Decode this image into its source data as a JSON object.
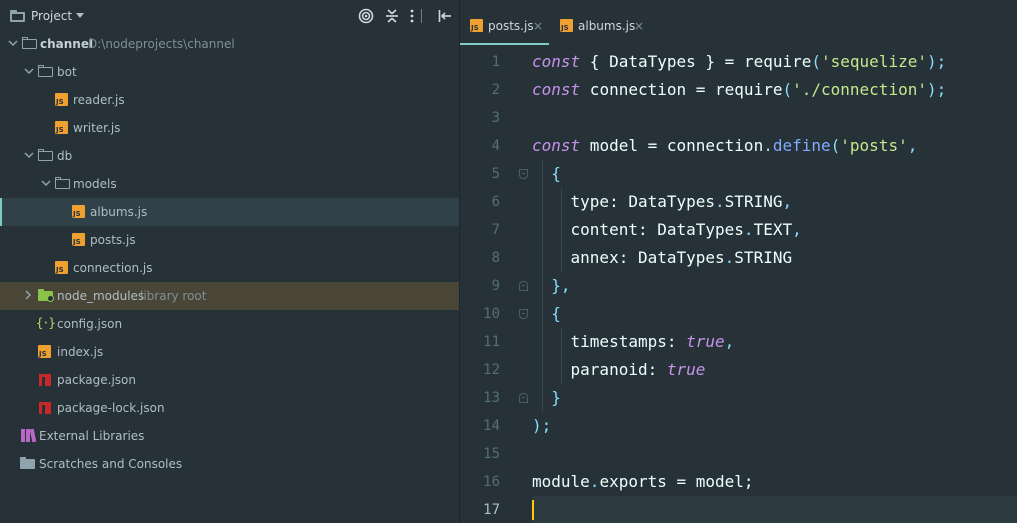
{
  "project_panel": {
    "title": "Project",
    "toolbar_icons": [
      "target-icon",
      "collapse-all-icon",
      "more-vert-icon",
      "hide-panel-icon"
    ],
    "tree": [
      {
        "label": "channel",
        "path": "D:\\nodeprojects\\channel",
        "type": "folder",
        "expanded": true,
        "depth": 0,
        "bold": true
      },
      {
        "label": "bot",
        "type": "folder",
        "expanded": true,
        "depth": 1
      },
      {
        "label": "reader.js",
        "type": "js",
        "depth": 2
      },
      {
        "label": "writer.js",
        "type": "js",
        "depth": 2
      },
      {
        "label": "db",
        "type": "folder",
        "expanded": true,
        "depth": 1
      },
      {
        "label": "models",
        "type": "folder",
        "expanded": true,
        "depth": 2
      },
      {
        "label": "albums.js",
        "type": "js",
        "depth": 3,
        "selected": true
      },
      {
        "label": "posts.js",
        "type": "js",
        "depth": 3
      },
      {
        "label": "connection.js",
        "type": "js",
        "depth": 2
      },
      {
        "label": "node_modules",
        "path": "library root",
        "type": "lib-folder",
        "expanded": false,
        "depth": 1,
        "excluded": true
      },
      {
        "label": "config.json",
        "type": "json",
        "depth": 1
      },
      {
        "label": "index.js",
        "type": "js",
        "depth": 1
      },
      {
        "label": "package.json",
        "type": "npm",
        "depth": 1
      },
      {
        "label": "package-lock.json",
        "type": "npm",
        "depth": 1
      },
      {
        "label": "External Libraries",
        "type": "libraries",
        "depth": 0
      },
      {
        "label": "Scratches and Consoles",
        "type": "scratches",
        "depth": 0
      }
    ]
  },
  "editor": {
    "tabs": [
      {
        "label": "posts.js",
        "close": "×",
        "active": true
      },
      {
        "label": "albums.js",
        "close": "×",
        "active": false
      }
    ],
    "current_line": 17,
    "lines": [
      [
        {
          "t": "const",
          "c": "kw"
        },
        {
          "t": " { DataTypes } = ",
          "c": "plain"
        },
        {
          "t": "require",
          "c": "plain"
        },
        {
          "t": "(",
          "c": "punc"
        },
        {
          "t": "'sequelize'",
          "c": "str"
        },
        {
          "t": ");",
          "c": "punc"
        }
      ],
      [
        {
          "t": "const",
          "c": "kw"
        },
        {
          "t": " connection = ",
          "c": "plain"
        },
        {
          "t": "require",
          "c": "plain"
        },
        {
          "t": "(",
          "c": "punc"
        },
        {
          "t": "'./connection'",
          "c": "str"
        },
        {
          "t": ");",
          "c": "punc"
        }
      ],
      [],
      [
        {
          "t": "const",
          "c": "kw"
        },
        {
          "t": " model = connection",
          "c": "plain"
        },
        {
          "t": ".",
          "c": "punc"
        },
        {
          "t": "define",
          "c": "fn"
        },
        {
          "t": "(",
          "c": "punc"
        },
        {
          "t": "'posts'",
          "c": "str"
        },
        {
          "t": ",",
          "c": "punc"
        }
      ],
      [
        {
          "t": "  {",
          "c": "punc"
        }
      ],
      [
        {
          "t": "    type: DataTypes",
          "c": "plain"
        },
        {
          "t": ".",
          "c": "punc"
        },
        {
          "t": "STRING",
          "c": "plain"
        },
        {
          "t": ",",
          "c": "punc"
        }
      ],
      [
        {
          "t": "    content: DataTypes",
          "c": "plain"
        },
        {
          "t": ".",
          "c": "punc"
        },
        {
          "t": "TEXT",
          "c": "plain"
        },
        {
          "t": ",",
          "c": "punc"
        }
      ],
      [
        {
          "t": "    annex: DataTypes",
          "c": "plain"
        },
        {
          "t": ".",
          "c": "punc"
        },
        {
          "t": "STRING",
          "c": "plain"
        }
      ],
      [
        {
          "t": "  },",
          "c": "punc"
        }
      ],
      [
        {
          "t": "  {",
          "c": "punc"
        }
      ],
      [
        {
          "t": "    timestamps: ",
          "c": "plain"
        },
        {
          "t": "true",
          "c": "bool"
        },
        {
          "t": ",",
          "c": "punc"
        }
      ],
      [
        {
          "t": "    paranoid: ",
          "c": "plain"
        },
        {
          "t": "true",
          "c": "bool"
        }
      ],
      [
        {
          "t": "  }",
          "c": "punc"
        }
      ],
      [
        {
          "t": ");",
          "c": "punc"
        }
      ],
      [],
      [
        {
          "t": "module",
          "c": "plain"
        },
        {
          "t": ".",
          "c": "punc"
        },
        {
          "t": "exports = model;",
          "c": "plain"
        }
      ],
      []
    ],
    "colors": {
      "kw": "#c792ea",
      "plain": "#eeffff",
      "punc": "#89ddff",
      "str": "#c3e88d",
      "fn": "#82aaff",
      "bool": "#c792ea",
      "accent": "#80cbc4",
      "caret": "#ffcc00"
    }
  }
}
